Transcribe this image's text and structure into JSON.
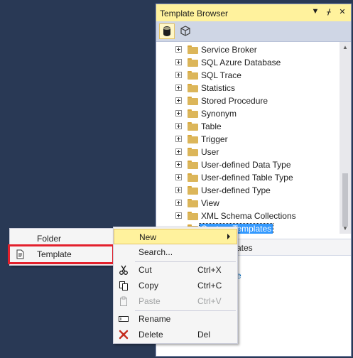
{
  "panel": {
    "title": "Template Browser",
    "buttons": {
      "dropdown": "▼",
      "pin": "ᚋ",
      "close": "✕"
    },
    "toolbar": {
      "db_icon": "database-icon",
      "cube_icon": "cube-icon"
    }
  },
  "tree": {
    "items": [
      {
        "label": "Service Broker"
      },
      {
        "label": "SQL Azure Database"
      },
      {
        "label": "SQL Trace"
      },
      {
        "label": "Statistics"
      },
      {
        "label": "Stored Procedure"
      },
      {
        "label": "Synonym"
      },
      {
        "label": "Table"
      },
      {
        "label": "Trigger"
      },
      {
        "label": "User"
      },
      {
        "label": "User-defined Data Type"
      },
      {
        "label": "User-defined Table Type"
      },
      {
        "label": "User-defined Type"
      },
      {
        "label": "View"
      },
      {
        "label": "XML Schema Collections"
      },
      {
        "label": "Custom Templates",
        "selected": true
      }
    ]
  },
  "lower": {
    "header_text": "ates",
    "link_text": "e"
  },
  "context_menu": {
    "items": [
      {
        "label": "New",
        "shortcut": "",
        "highlighted": true,
        "submenu": true
      },
      {
        "label": "Search...",
        "shortcut": ""
      },
      {
        "label": "Cut",
        "shortcut": "Ctrl+X",
        "icon": "scissors-icon"
      },
      {
        "label": "Copy",
        "shortcut": "Ctrl+C",
        "icon": "copy-icon"
      },
      {
        "label": "Paste",
        "shortcut": "Ctrl+V",
        "icon": "paste-icon",
        "disabled": true
      },
      {
        "label": "Rename",
        "shortcut": "",
        "icon": "rename-icon"
      },
      {
        "label": "Delete",
        "shortcut": "Del",
        "icon": "delete-icon"
      }
    ]
  },
  "submenu": {
    "items": [
      {
        "label": "Folder"
      },
      {
        "label": "Template",
        "icon": "template-icon"
      }
    ]
  },
  "colors": {
    "background": "#293955",
    "titlebar": "#fff29d",
    "selection": "#3399ff",
    "highlight_border": "#e3202c"
  }
}
